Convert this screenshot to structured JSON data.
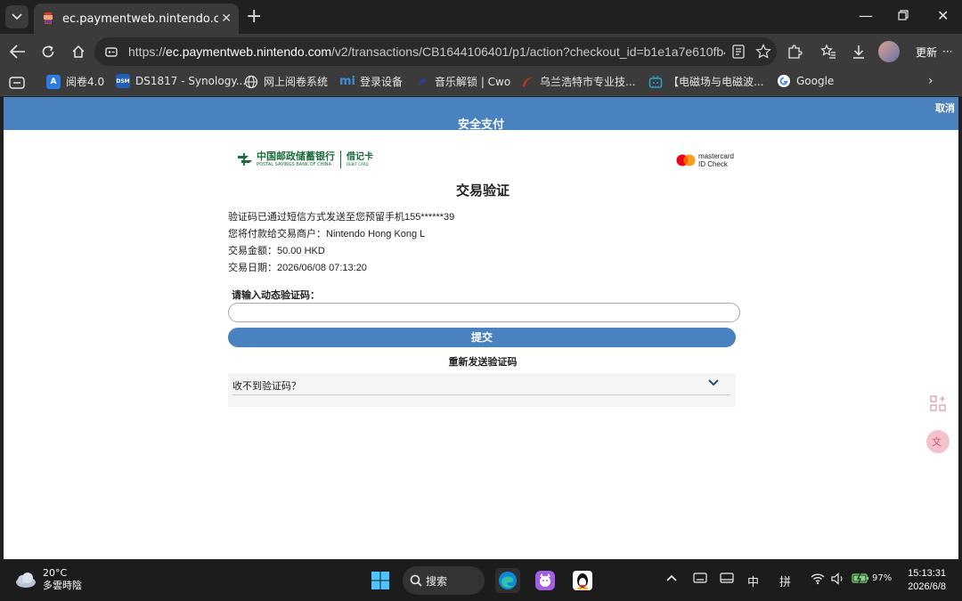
{
  "browser": {
    "tab_title": "ec.paymentweb.nintendo.com/v2/",
    "url_host": "ec.paymentweb.nintendo.com",
    "url_prefix": "https://",
    "url_path": "/v2/transactions/CB1644106401/p1/action?checkout_id=b1e1a7e610fb463f...",
    "update_label": "更新",
    "more_label": "···"
  },
  "bookmarks": [
    {
      "label": "阅卷4.0",
      "icon": "A",
      "color": "#2d7de0"
    },
    {
      "label": "DS1817 - Synology...",
      "icon": "DSM",
      "color": "#1f5fb5"
    },
    {
      "label": "网上阅卷系统",
      "icon": "globe",
      "color": "#555"
    },
    {
      "label": "登录设备",
      "icon": "mi",
      "color": "#3d8fe0"
    },
    {
      "label": "音乐解锁 | Cwo",
      "icon": "bird",
      "color": "#2a3f8c"
    },
    {
      "label": "乌兰浩特市专业技...",
      "icon": "swoosh",
      "color": "#c0392b"
    },
    {
      "label": "【电磁场与电磁波...",
      "icon": "tv",
      "color": "#23a6d5"
    },
    {
      "label": "Google",
      "icon": "G",
      "color": "#4285f4"
    }
  ],
  "page": {
    "header_title": "安全支付",
    "cancel_label": "取消",
    "bank_name_cn": "中国邮政储蓄银行",
    "bank_name_en": "POSTAL SAVINGS BANK OF CHINA",
    "card_type_cn": "借记卡",
    "card_type_en": "DEBIT CARD",
    "mastercard_label": "mastercard",
    "mastercard_sub": "ID Check",
    "verify_title": "交易验证",
    "info_lines": [
      "验证码已通过短信方式发送至您预留手机155******39",
      "您将付款给交易商户：Nintendo Hong Kong L",
      "交易金额：50.00 HKD",
      "交易日期：2026/06/08 07:13:20"
    ],
    "otp_label": "请输入动态验证码：",
    "otp_value": "",
    "submit_label": "提交",
    "resend_label": "重新发送验证码",
    "faq_label": "收不到验证码？"
  },
  "taskbar": {
    "temp": "20°C",
    "weather_desc": "多雲時陰",
    "search_label": "搜索",
    "ime_mode": "中",
    "ime_pinyin": "拼",
    "battery": "97%",
    "time": "15:13:31",
    "date": "2026/6/8"
  }
}
